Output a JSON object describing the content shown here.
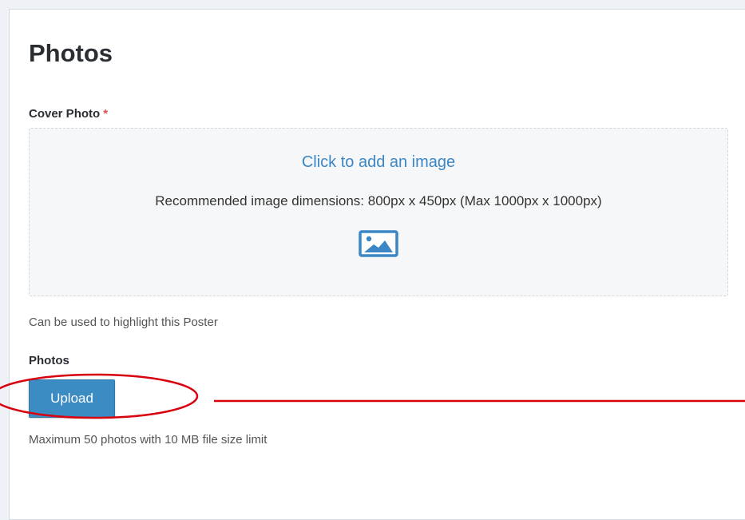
{
  "page": {
    "title": "Photos"
  },
  "cover_photo": {
    "label": "Cover Photo",
    "required_mark": "*",
    "dropzone_link": "Click to add an image",
    "dropzone_hint": "Recommended image dimensions: 800px x 450px (Max 1000px x 1000px)",
    "icon": "image-icon",
    "help_text": "Can be used to highlight this Poster"
  },
  "photos": {
    "label": "Photos",
    "upload_label": "Upload",
    "help_text": "Maximum 50 photos with 10 MB file size limit"
  },
  "colors": {
    "accent": "#3a8cc2",
    "link": "#3b86c4",
    "required": "#d9534f",
    "annotation": "#d9000d"
  }
}
